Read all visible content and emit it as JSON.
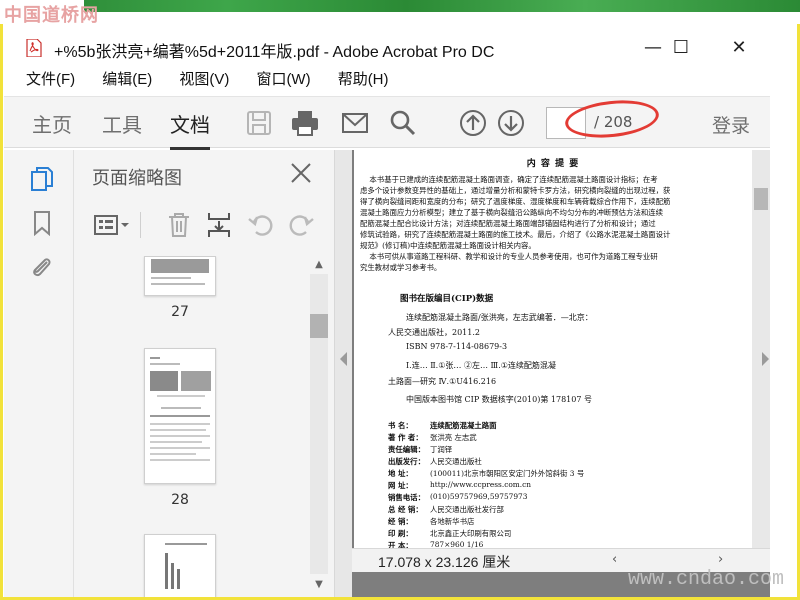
{
  "watermark_top": "中国道桥网",
  "watermark_bottom": "www.cndao.com",
  "window": {
    "title": "+%5b张洪亮+编著%5d+2011年版.pdf - Adobe Acrobat Pro DC",
    "minimize": "—",
    "maximize": "☐",
    "close": "✕"
  },
  "menu": [
    "文件(F)",
    "编辑(E)",
    "视图(V)",
    "窗口(W)",
    "帮助(H)"
  ],
  "toolbar": {
    "tabs": [
      "主页",
      "工具",
      "文档"
    ],
    "active_tab": "文档",
    "icons": [
      "save-icon",
      "print-icon",
      "email-icon",
      "search-icon",
      "page-up-icon",
      "page-down-icon"
    ],
    "page_current": "",
    "page_total": "/ 208",
    "login": "登录"
  },
  "panel": {
    "title": "页面缩略图",
    "thumbnails": [
      {
        "label": "27"
      },
      {
        "label": "28"
      },
      {
        "label": ""
      }
    ]
  },
  "document": {
    "heading": "内 容 提 要",
    "summary_lines": [
      "    本书基于已建成的连续配筋混凝土路面调查，确定了连续配筋混凝土路面设计指标；在考",
      "虑多个设计参数变异性的基础上，通过增量分析和蒙特卡罗方法，研究横向裂缝的出现过程，获",
      "得了横向裂缝间距和宽度的分布；研究了温度梯度、湿度梯度和车辆荷载综合作用下，连续配筋",
      "混凝土路面应力分析模型；建立了基于横向裂缝沿公路纵向不均匀分布的冲断预估方法和连续",
      "配筋混凝土配合比设计方法；对连续配筋混凝土路面端部锚固结构进行了分析和设计；通过",
      "修筑试验路，研究了连续配筋混凝土路面的施工技术。最后，介绍了《公路水泥混凝土路面设计",
      "规范》(修订稿)中连续配筋混凝土路面设计相关内容。",
      "    本书可供从事道路工程科研、教学和设计的专业人员参考使用，也可作为道路工程专业研",
      "究生教材或学习参考书。"
    ],
    "cip_title": "图书在版编目(CIP)数据",
    "cip_lines": [
      "连续配筋混凝土路面/张洪亮，左志武编著．—北京：",
      "人民交通出版社，2011.2",
      "ISBN  978-7-114-08679-3",
      "Ⅰ.连…   Ⅱ.①张…  ②左…    Ⅲ.①连续配筋混凝",
      "土路面—研究   Ⅳ.①U416.216",
      "中国版本图书馆 CIP 数据核字(2010)第 178107 号"
    ],
    "colophon": [
      {
        "k": "书        名：",
        "v": "连续配筋混凝土路面"
      },
      {
        "k": "著  作  者：",
        "v": "张洪亮    左志武"
      },
      {
        "k": "责任编辑：",
        "v": "丁润铎"
      },
      {
        "k": "出版发行：",
        "v": "人民交通出版社"
      },
      {
        "k": "地        址：",
        "v": "(100011)北京市朝阳区安定门外外馆斜街 3 号"
      },
      {
        "k": "网        址：",
        "v": "http://www.ccpress.com.cn"
      },
      {
        "k": "销售电话：",
        "v": "(010)59757969,59757973"
      },
      {
        "k": "总  经  销：",
        "v": "人民交通出版社发行部"
      },
      {
        "k": "经        销：",
        "v": "各地新华书店"
      },
      {
        "k": "印        刷：",
        "v": "北京鑫正大印刷有限公司"
      },
      {
        "k": "开        本：",
        "v": "787×960   1/16"
      }
    ]
  },
  "status": {
    "page_size": "17.078 x 23.126 厘米"
  },
  "colors": {
    "frame": "#f2e23a",
    "annotation": "#e33b34",
    "toolbar_bg": "#f4f4f4",
    "doc_bg": "#7e7e7e"
  }
}
